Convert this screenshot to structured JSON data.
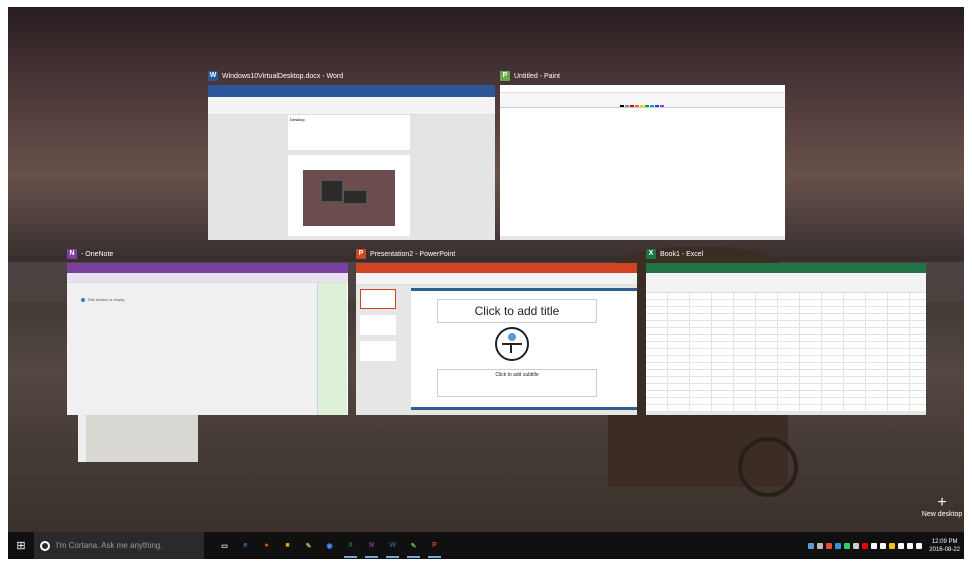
{
  "windows": {
    "word": {
      "title": "Windows10VirtualDesktop.docx - Word",
      "icon": "W",
      "color": "#2b579a",
      "doc_heading": "Desktop"
    },
    "paint": {
      "title": "Untitled - Paint",
      "icon": "P",
      "color": "#6aa84f"
    },
    "onenote": {
      "title": "- OneNote",
      "icon": "N",
      "color": "#7b3fa0",
      "note_text": "This section is empty."
    },
    "powerpoint": {
      "title": "Presentation2 - PowerPoint",
      "icon": "P",
      "color": "#d04423",
      "slide_title": "Click to add title",
      "slide_subtitle": "Click to add subtitle"
    },
    "excel": {
      "title": "Book1 - Excel",
      "icon": "X",
      "color": "#217346"
    }
  },
  "new_desktop": {
    "plus": "+",
    "label": "New desktop"
  },
  "taskbar": {
    "start_icon": "⊞",
    "search_placeholder": "I'm Cortana. Ask me anything.",
    "pinned": [
      {
        "name": "task-view",
        "glyph": "▭",
        "color": "#ffffff"
      },
      {
        "name": "edge",
        "glyph": "e",
        "color": "#2b7cd3"
      },
      {
        "name": "firefox",
        "glyph": "●",
        "color": "#e66000"
      },
      {
        "name": "file-explorer",
        "glyph": "■",
        "color": "#e8b400"
      },
      {
        "name": "paint-pinned",
        "glyph": "✎",
        "color": "#9bbf6a"
      },
      {
        "name": "chrome",
        "glyph": "◉",
        "color": "#4c8bf5"
      },
      {
        "name": "excel",
        "glyph": "X",
        "color": "#217346"
      },
      {
        "name": "onenote",
        "glyph": "N",
        "color": "#7b3fa0"
      },
      {
        "name": "word",
        "glyph": "W",
        "color": "#2b579a"
      },
      {
        "name": "paint",
        "glyph": "✎",
        "color": "#6aa84f"
      },
      {
        "name": "powerpoint",
        "glyph": "P",
        "color": "#d04423"
      }
    ],
    "clock_time": "12:09 PM",
    "clock_date": "2016-08-22"
  }
}
